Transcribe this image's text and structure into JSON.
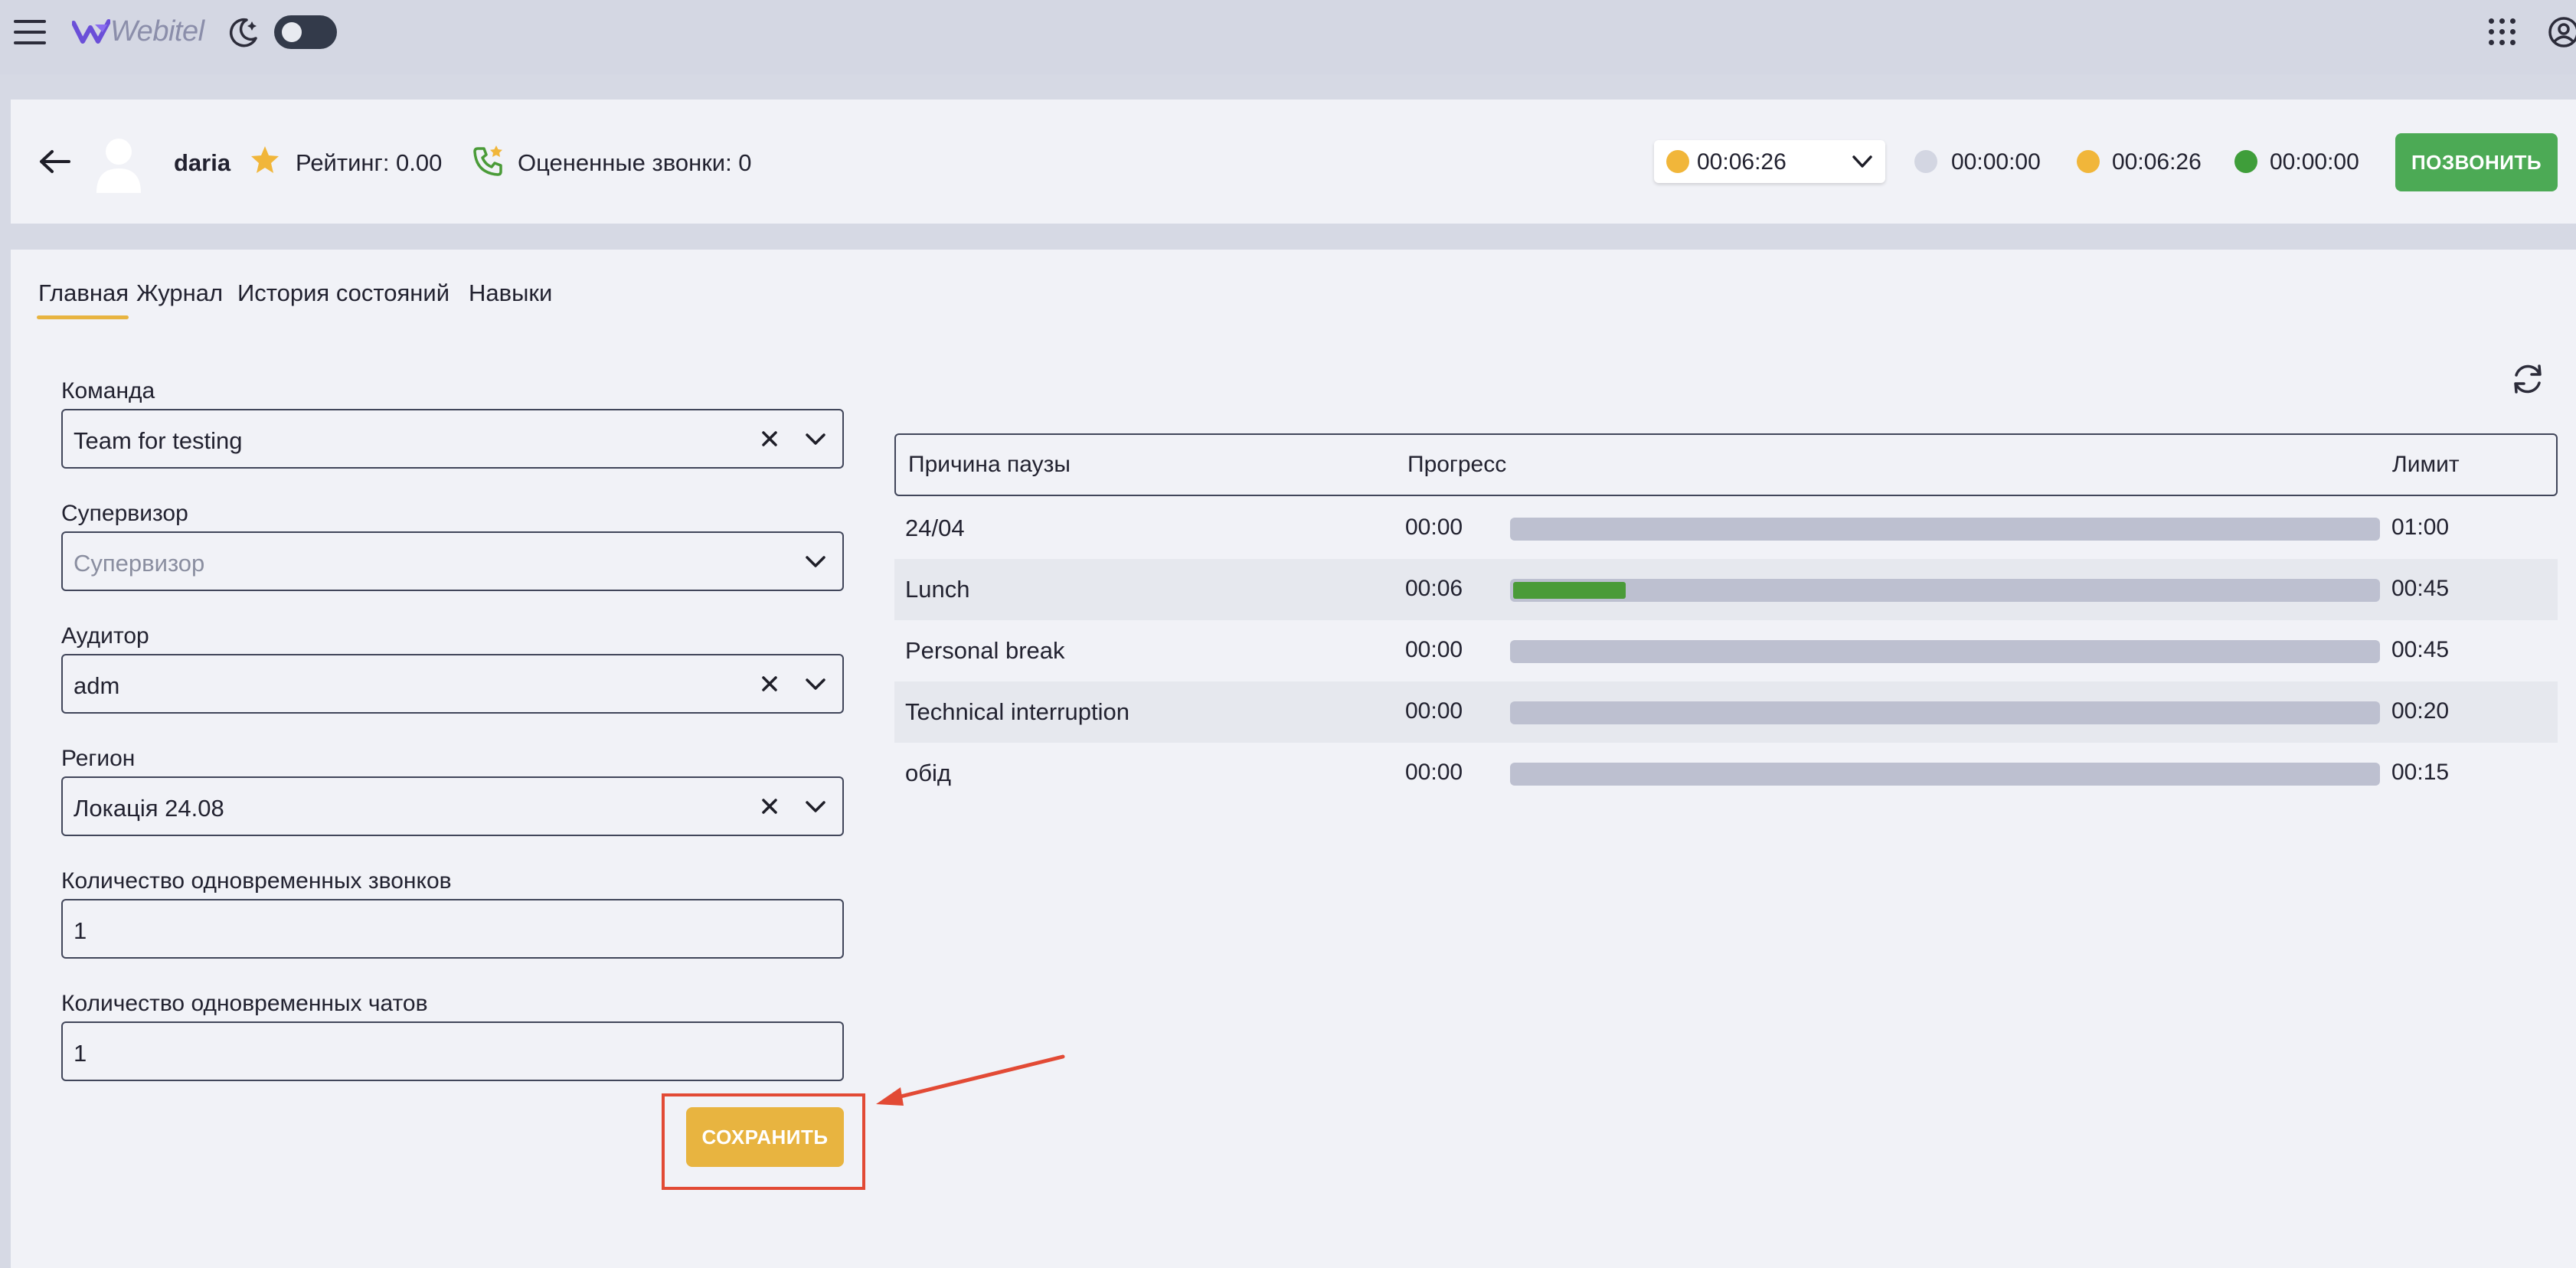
{
  "app": {
    "logo_text": "Webitel"
  },
  "agent": {
    "name": "daria",
    "rating_text": "Рейтинг: 0.00",
    "rated_calls_text": "Оцененные звонки: 0"
  },
  "status": {
    "current": {
      "time": "00:06:26",
      "color": "#f1b63a"
    },
    "timers": [
      {
        "time": "00:00:00",
        "color": "#d3d6e2"
      },
      {
        "time": "00:06:26",
        "color": "#f1b63a"
      },
      {
        "time": "00:00:00",
        "color": "#3f9e3a"
      }
    ]
  },
  "call_button_label": "ПОЗВОНИТЬ",
  "tabs": [
    {
      "label": "Главная",
      "active": true
    },
    {
      "label": "Журнал",
      "active": false
    },
    {
      "label": "История состояний",
      "active": false
    },
    {
      "label": "Навыки",
      "active": false
    }
  ],
  "form": {
    "team": {
      "label": "Команда",
      "value": "Team for testing"
    },
    "supervisor": {
      "label": "Супервизор",
      "placeholder": "Супервизор"
    },
    "auditor": {
      "label": "Аудитор",
      "value": "adm"
    },
    "region": {
      "label": "Регион",
      "value": "Локація 24.08"
    },
    "concurrent_calls": {
      "label": "Количество одновременных звонков",
      "value": "1"
    },
    "concurrent_chats": {
      "label": "Количество одновременных чатов",
      "value": "1"
    },
    "save_label": "СОХРАНИТЬ"
  },
  "pause_table": {
    "headers": {
      "reason": "Причина паузы",
      "progress": "Прогресс",
      "limit": "Лимит"
    },
    "rows": [
      {
        "reason": "24/04",
        "elapsed": "00:00",
        "limit": "01:00",
        "progress_fraction": 0
      },
      {
        "reason": "Lunch",
        "elapsed": "00:06",
        "limit": "00:45",
        "progress_fraction": 0.13
      },
      {
        "reason": "Personal break",
        "elapsed": "00:00",
        "limit": "00:45",
        "progress_fraction": 0
      },
      {
        "reason": "Technical interruption",
        "elapsed": "00:00",
        "limit": "00:20",
        "progress_fraction": 0
      },
      {
        "reason": "обід",
        "elapsed": "00:00",
        "limit": "00:15",
        "progress_fraction": 0
      }
    ]
  },
  "colors": {
    "accent": "#e8b440",
    "call_button": "#4caa55",
    "progress_fill": "#4a9b38",
    "annotation": "#e24a35"
  }
}
